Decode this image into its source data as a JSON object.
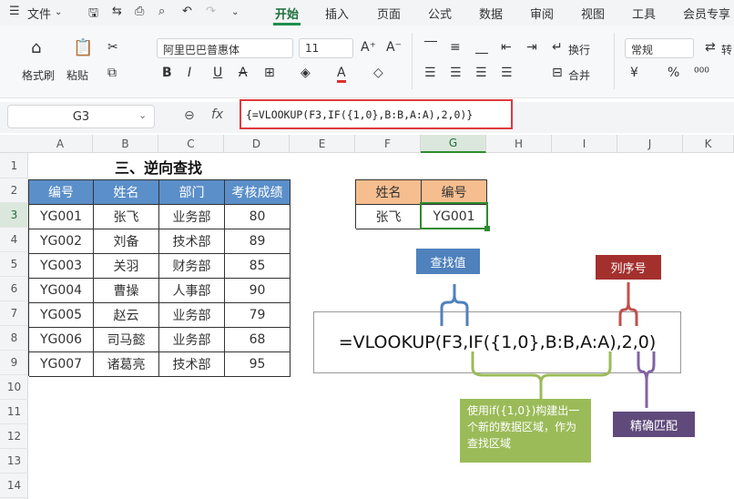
{
  "menubar": {
    "file": "文件",
    "tabs": [
      "开始",
      "插入",
      "页面",
      "公式",
      "数据",
      "审阅",
      "视图",
      "工具",
      "会员专享"
    ],
    "active_tab": "开始"
  },
  "ribbon": {
    "format_painter": "格式刷",
    "paste": "粘贴",
    "font_name": "阿里巴巴普惠体",
    "font_size": "11",
    "wrap": "换行",
    "merge": "合并",
    "number_format": "常规",
    "convert": "转"
  },
  "formula_bar": {
    "name_box": "G3",
    "fx": "fx",
    "formula": "{=VLOOKUP(F3,IF({1,0},B:B,A:A),2,0)}"
  },
  "columns": [
    "A",
    "B",
    "C",
    "D",
    "E",
    "F",
    "G",
    "H",
    "I",
    "J",
    "K"
  ],
  "rows": [
    "1",
    "2",
    "3",
    "4",
    "5",
    "6",
    "7",
    "8",
    "9",
    "10",
    "11",
    "12",
    "13",
    "14"
  ],
  "title": "三、逆向查找",
  "table": {
    "headers": [
      "编号",
      "姓名",
      "部门",
      "考核成绩"
    ],
    "rows": [
      [
        "YG001",
        "张飞",
        "业务部",
        "80"
      ],
      [
        "YG002",
        "刘备",
        "技术部",
        "89"
      ],
      [
        "YG003",
        "关羽",
        "财务部",
        "85"
      ],
      [
        "YG004",
        "曹操",
        "人事部",
        "90"
      ],
      [
        "YG005",
        "赵云",
        "业务部",
        "79"
      ],
      [
        "YG006",
        "司马懿",
        "业务部",
        "68"
      ],
      [
        "YG007",
        "诸葛亮",
        "技术部",
        "95"
      ]
    ]
  },
  "lookup": {
    "headers": [
      "姓名",
      "编号"
    ],
    "name": "张飞",
    "result": "YG001"
  },
  "diagram": {
    "formula": "=VLOOKUP(F3,IF({1,0},B:B,A:A),2,0)",
    "lookup_value": "查找值",
    "col_index": "列序号",
    "if_note": "使用if({1,0})构建出一个新的数据区域，作为查找区域",
    "exact": "精确匹配"
  },
  "colors": {
    "header_blue": "#5b8fc9",
    "lookup_orange": "#f6be8f",
    "accent_green": "#2e8b2e"
  }
}
